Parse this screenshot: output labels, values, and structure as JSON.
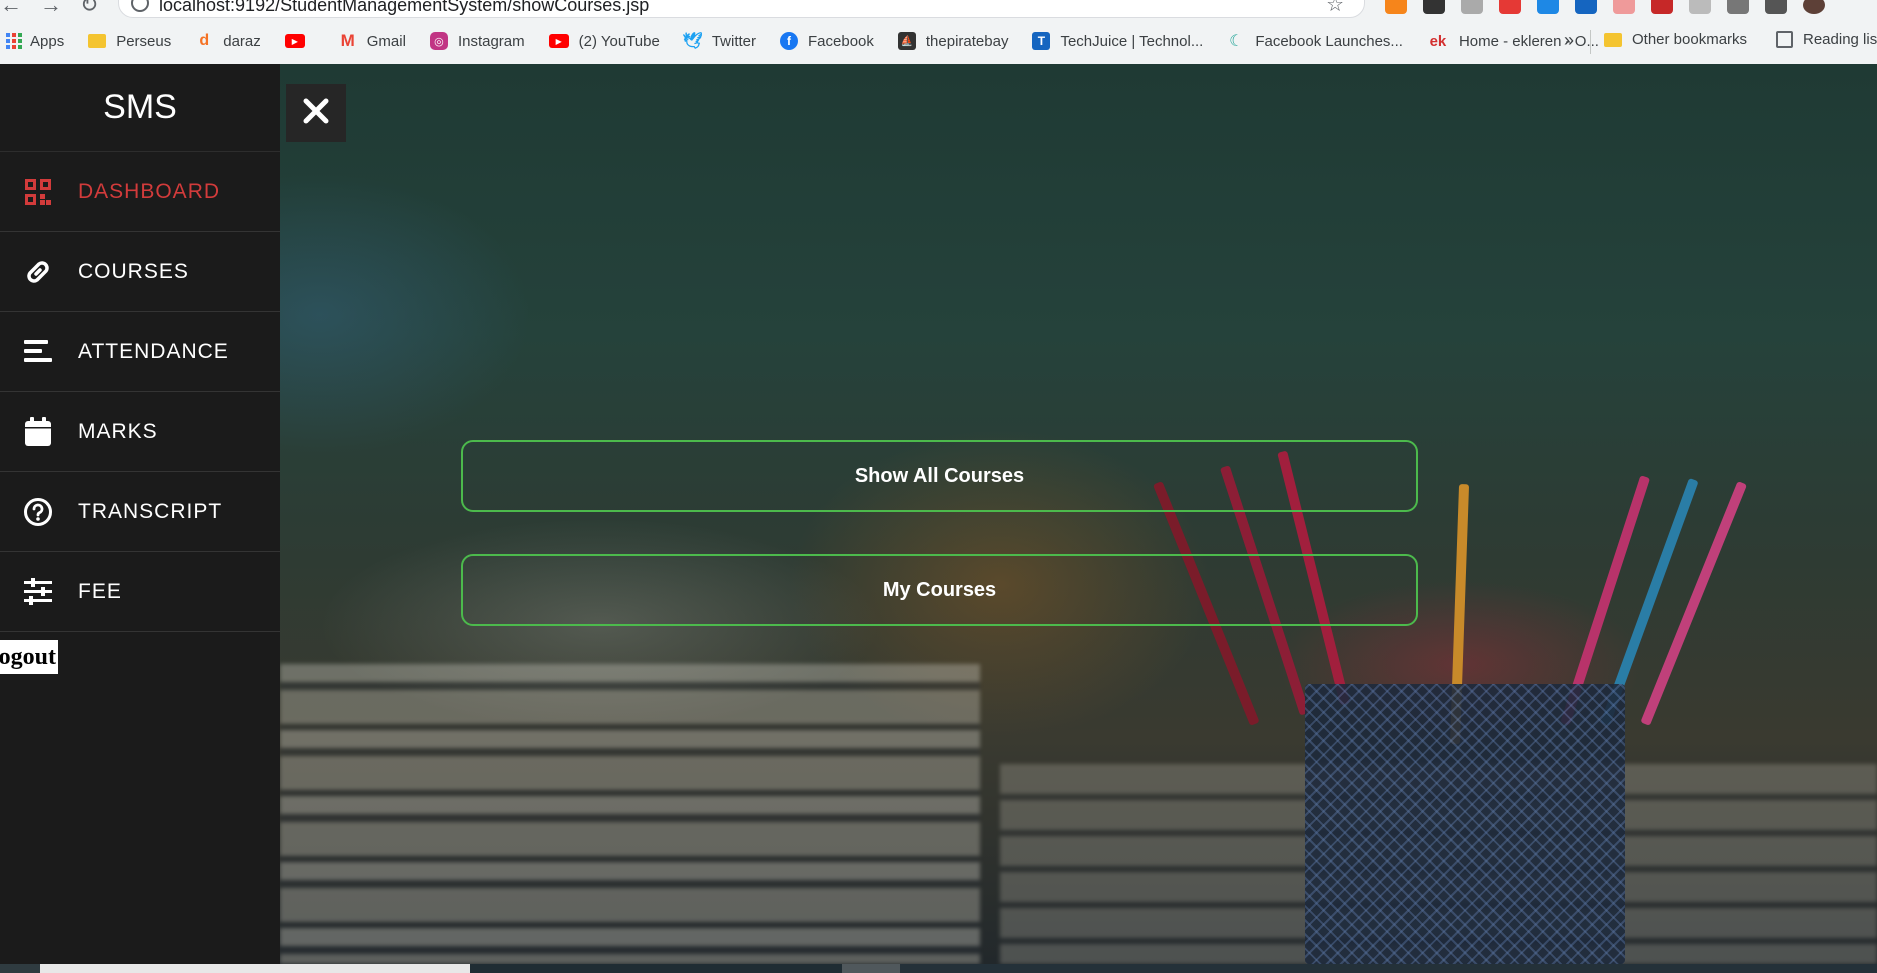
{
  "browser": {
    "url": "localhost:9192/StudentManagementSystem/showCourses.jsp",
    "bookmarks": [
      {
        "label": "Apps",
        "icon": "apps-grid-icon"
      },
      {
        "label": "Perseus",
        "icon": "folder-icon",
        "color": "#f4c430"
      },
      {
        "label": "daraz",
        "icon": "daraz-icon",
        "color": "#f57224"
      },
      {
        "label": "",
        "icon": "youtube-icon",
        "color": "#ff0000"
      },
      {
        "label": "Gmail",
        "icon": "gmail-icon",
        "color": "#ea4335"
      },
      {
        "label": "Instagram",
        "icon": "instagram-icon",
        "color": "#c13584"
      },
      {
        "label": "(2) YouTube",
        "icon": "youtube-icon",
        "color": "#ff0000"
      },
      {
        "label": "Twitter",
        "icon": "twitter-icon",
        "color": "#1da1f2"
      },
      {
        "label": "Facebook",
        "icon": "facebook-icon",
        "color": "#1877f2"
      },
      {
        "label": "thepiratebay",
        "icon": "pirate-icon",
        "color": "#333333"
      },
      {
        "label": "TechJuice | Technol...",
        "icon": "techjuice-icon",
        "color": "#1565c0"
      },
      {
        "label": "Facebook Launches...",
        "icon": "article-icon",
        "color": "#26a69a"
      },
      {
        "label": "Home - ekleren - O...",
        "icon": "ek-icon",
        "color": "#d32f2f"
      }
    ],
    "more": "»",
    "other_bookmarks": "Other bookmarks",
    "reading_list": "Reading lis"
  },
  "sidebar": {
    "brand": "SMS",
    "items": [
      {
        "label": "DASHBOARD",
        "icon": "dashboard-icon",
        "active": true
      },
      {
        "label": "COURSES",
        "icon": "link-icon",
        "active": false
      },
      {
        "label": "ATTENDANCE",
        "icon": "bars-icon",
        "active": false
      },
      {
        "label": "MARKS",
        "icon": "calendar-icon",
        "active": false
      },
      {
        "label": "TRANSCRIPT",
        "icon": "question-icon",
        "active": false
      },
      {
        "label": "FEE",
        "icon": "sliders-icon",
        "active": false
      }
    ],
    "logout": "Logout"
  },
  "main": {
    "show_all_courses": "Show All Courses",
    "my_courses": "My Courses"
  },
  "colors": {
    "accent_red": "#d23b3b",
    "button_border": "#4cba4c",
    "sidebar_bg": "#1b1b1b"
  }
}
